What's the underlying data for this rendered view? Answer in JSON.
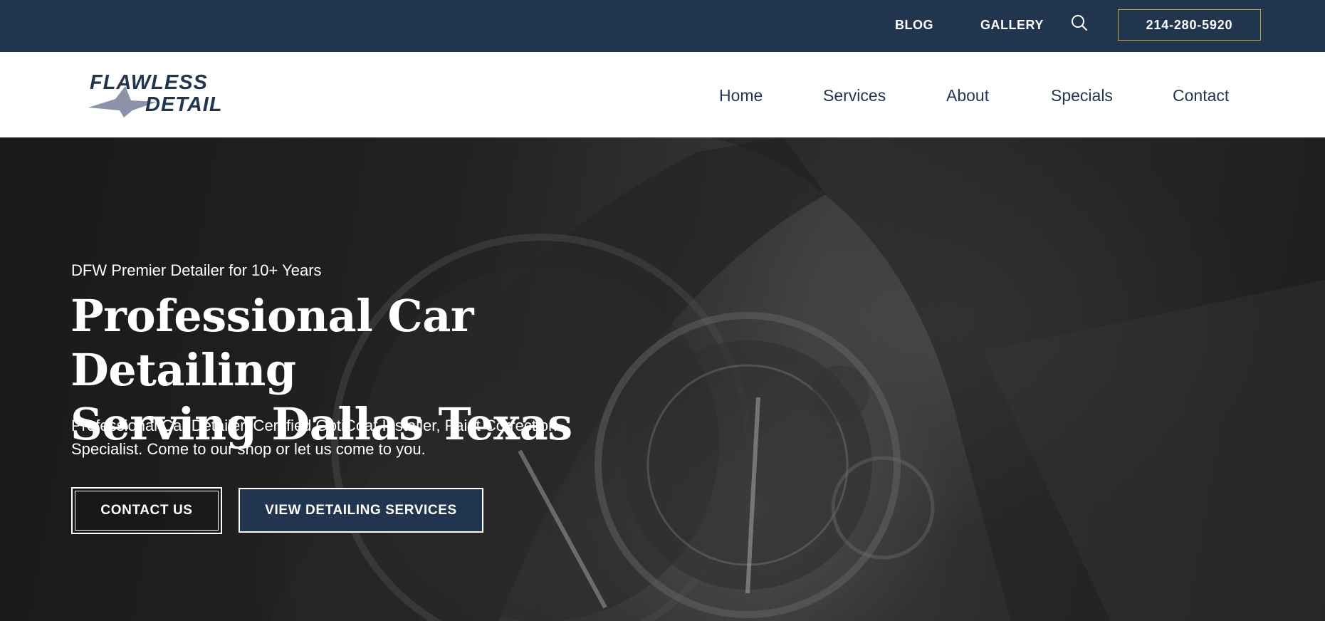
{
  "topbar": {
    "blog_label": "BLOG",
    "gallery_label": "GALLERY",
    "search_icon": "search-icon",
    "phone": "214-280-5920"
  },
  "logo": {
    "line1": "FLAWLESS",
    "line2": "DETAIL"
  },
  "nav": {
    "items": [
      {
        "label": "Home"
      },
      {
        "label": "Services"
      },
      {
        "label": "About"
      },
      {
        "label": "Specials"
      },
      {
        "label": "Contact"
      }
    ]
  },
  "hero": {
    "tagline": "DFW Premier Detailer for 10+ Years",
    "headline_line1": "Professional Car Detailing",
    "headline_line2": "Serving Dallas Texas",
    "subtext": "Professional Car Detailer, Certified OptiCoat Installer, Paint Correction Specialist. Come to our shop or let us come to you.",
    "cta_primary": "CONTACT US",
    "cta_secondary": "VIEW DETAILING SERVICES"
  },
  "colors": {
    "navy": "#22354f",
    "gold_border": "#c9a93a",
    "white": "#ffffff",
    "logo_gray": "#8c93a8"
  }
}
